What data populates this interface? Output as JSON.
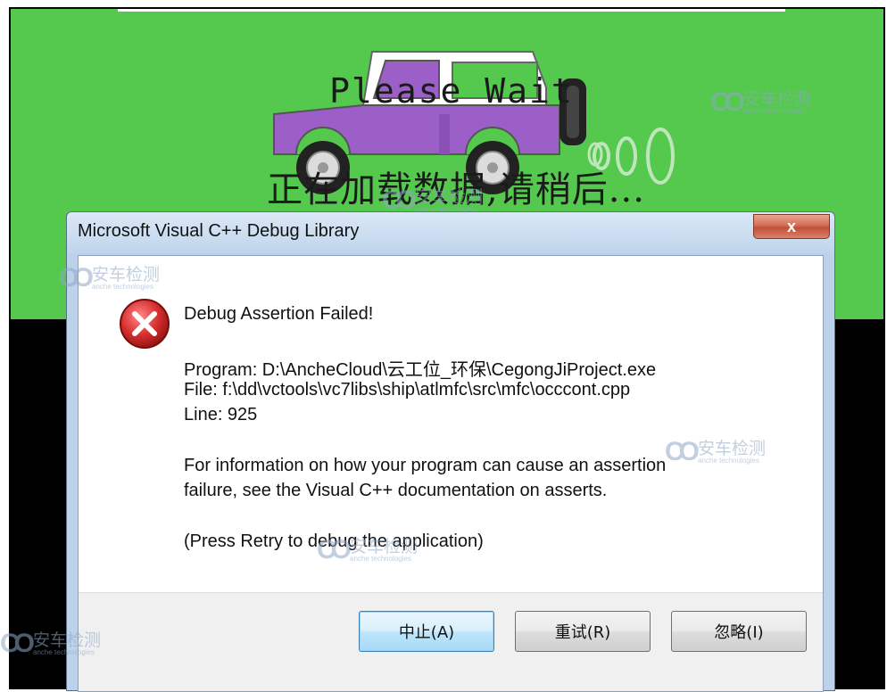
{
  "background": {
    "please_wait": "Please Wait",
    "loading_text": "正在加载数据,请稍后..."
  },
  "watermark": {
    "logo": "CO",
    "cn": "安车检测",
    "en": "anche technologies"
  },
  "dialog": {
    "title": "Microsoft Visual C++ Debug Library",
    "close_glyph": "x",
    "heading": "Debug Assertion Failed!",
    "program_line": "Program: D:\\AncheCloud\\云工位_环保\\CegongJiProject.exe",
    "file_line": "File: f:\\dd\\vctools\\vc7libs\\ship\\atlmfc\\src\\mfc\\occcont.cpp",
    "line_line": "Line: 925",
    "info_line1": "For information on how your program can cause an assertion",
    "info_line2": "failure, see the Visual C++ documentation on asserts.",
    "retry_hint": "(Press Retry to debug the application)",
    "buttons": {
      "abort": "中止(A)",
      "retry": "重试(R)",
      "ignore": "忽略(I)"
    }
  },
  "colors": {
    "background_green": "#54c94e",
    "jeep_body": "#9b5fc7",
    "error_red": "#d83030"
  }
}
